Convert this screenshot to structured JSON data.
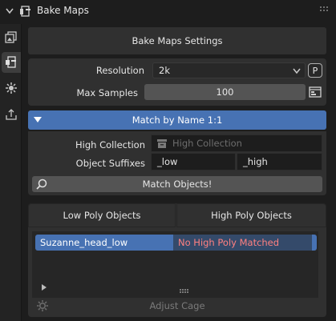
{
  "header": {
    "title": "Bake Maps"
  },
  "tabs": [
    {
      "icon": "image-layers-icon",
      "active": false
    },
    {
      "icon": "bake-tool-icon",
      "active": true
    },
    {
      "icon": "gear-sparkle-icon",
      "active": false
    },
    {
      "icon": "export-icon",
      "active": false
    }
  ],
  "settings": {
    "button_label": "Bake Maps Settings",
    "resolution_label": "Resolution",
    "resolution_value": "2k",
    "pin_label": "P",
    "max_samples_label": "Max Samples",
    "max_samples_value": "100"
  },
  "match": {
    "header_label": "Match by Name 1:1",
    "high_collection_label": "High Collection",
    "high_collection_placeholder": "High Collection",
    "object_suffixes_label": "Object Suffixes",
    "low_suffix": "_low",
    "high_suffix": "_high",
    "match_button_label": "Match Objects!"
  },
  "objects": {
    "low_tab_label": "Low Poly Objects",
    "high_tab_label": "High Poly Objects",
    "rows": [
      {
        "low": "Suzanne_head_low",
        "high": "No High Poly Matched"
      }
    ],
    "adjust_cage_label": "Adjust Cage"
  },
  "colors": {
    "accent": "#4772b3",
    "warning_text": "#ff8080"
  }
}
